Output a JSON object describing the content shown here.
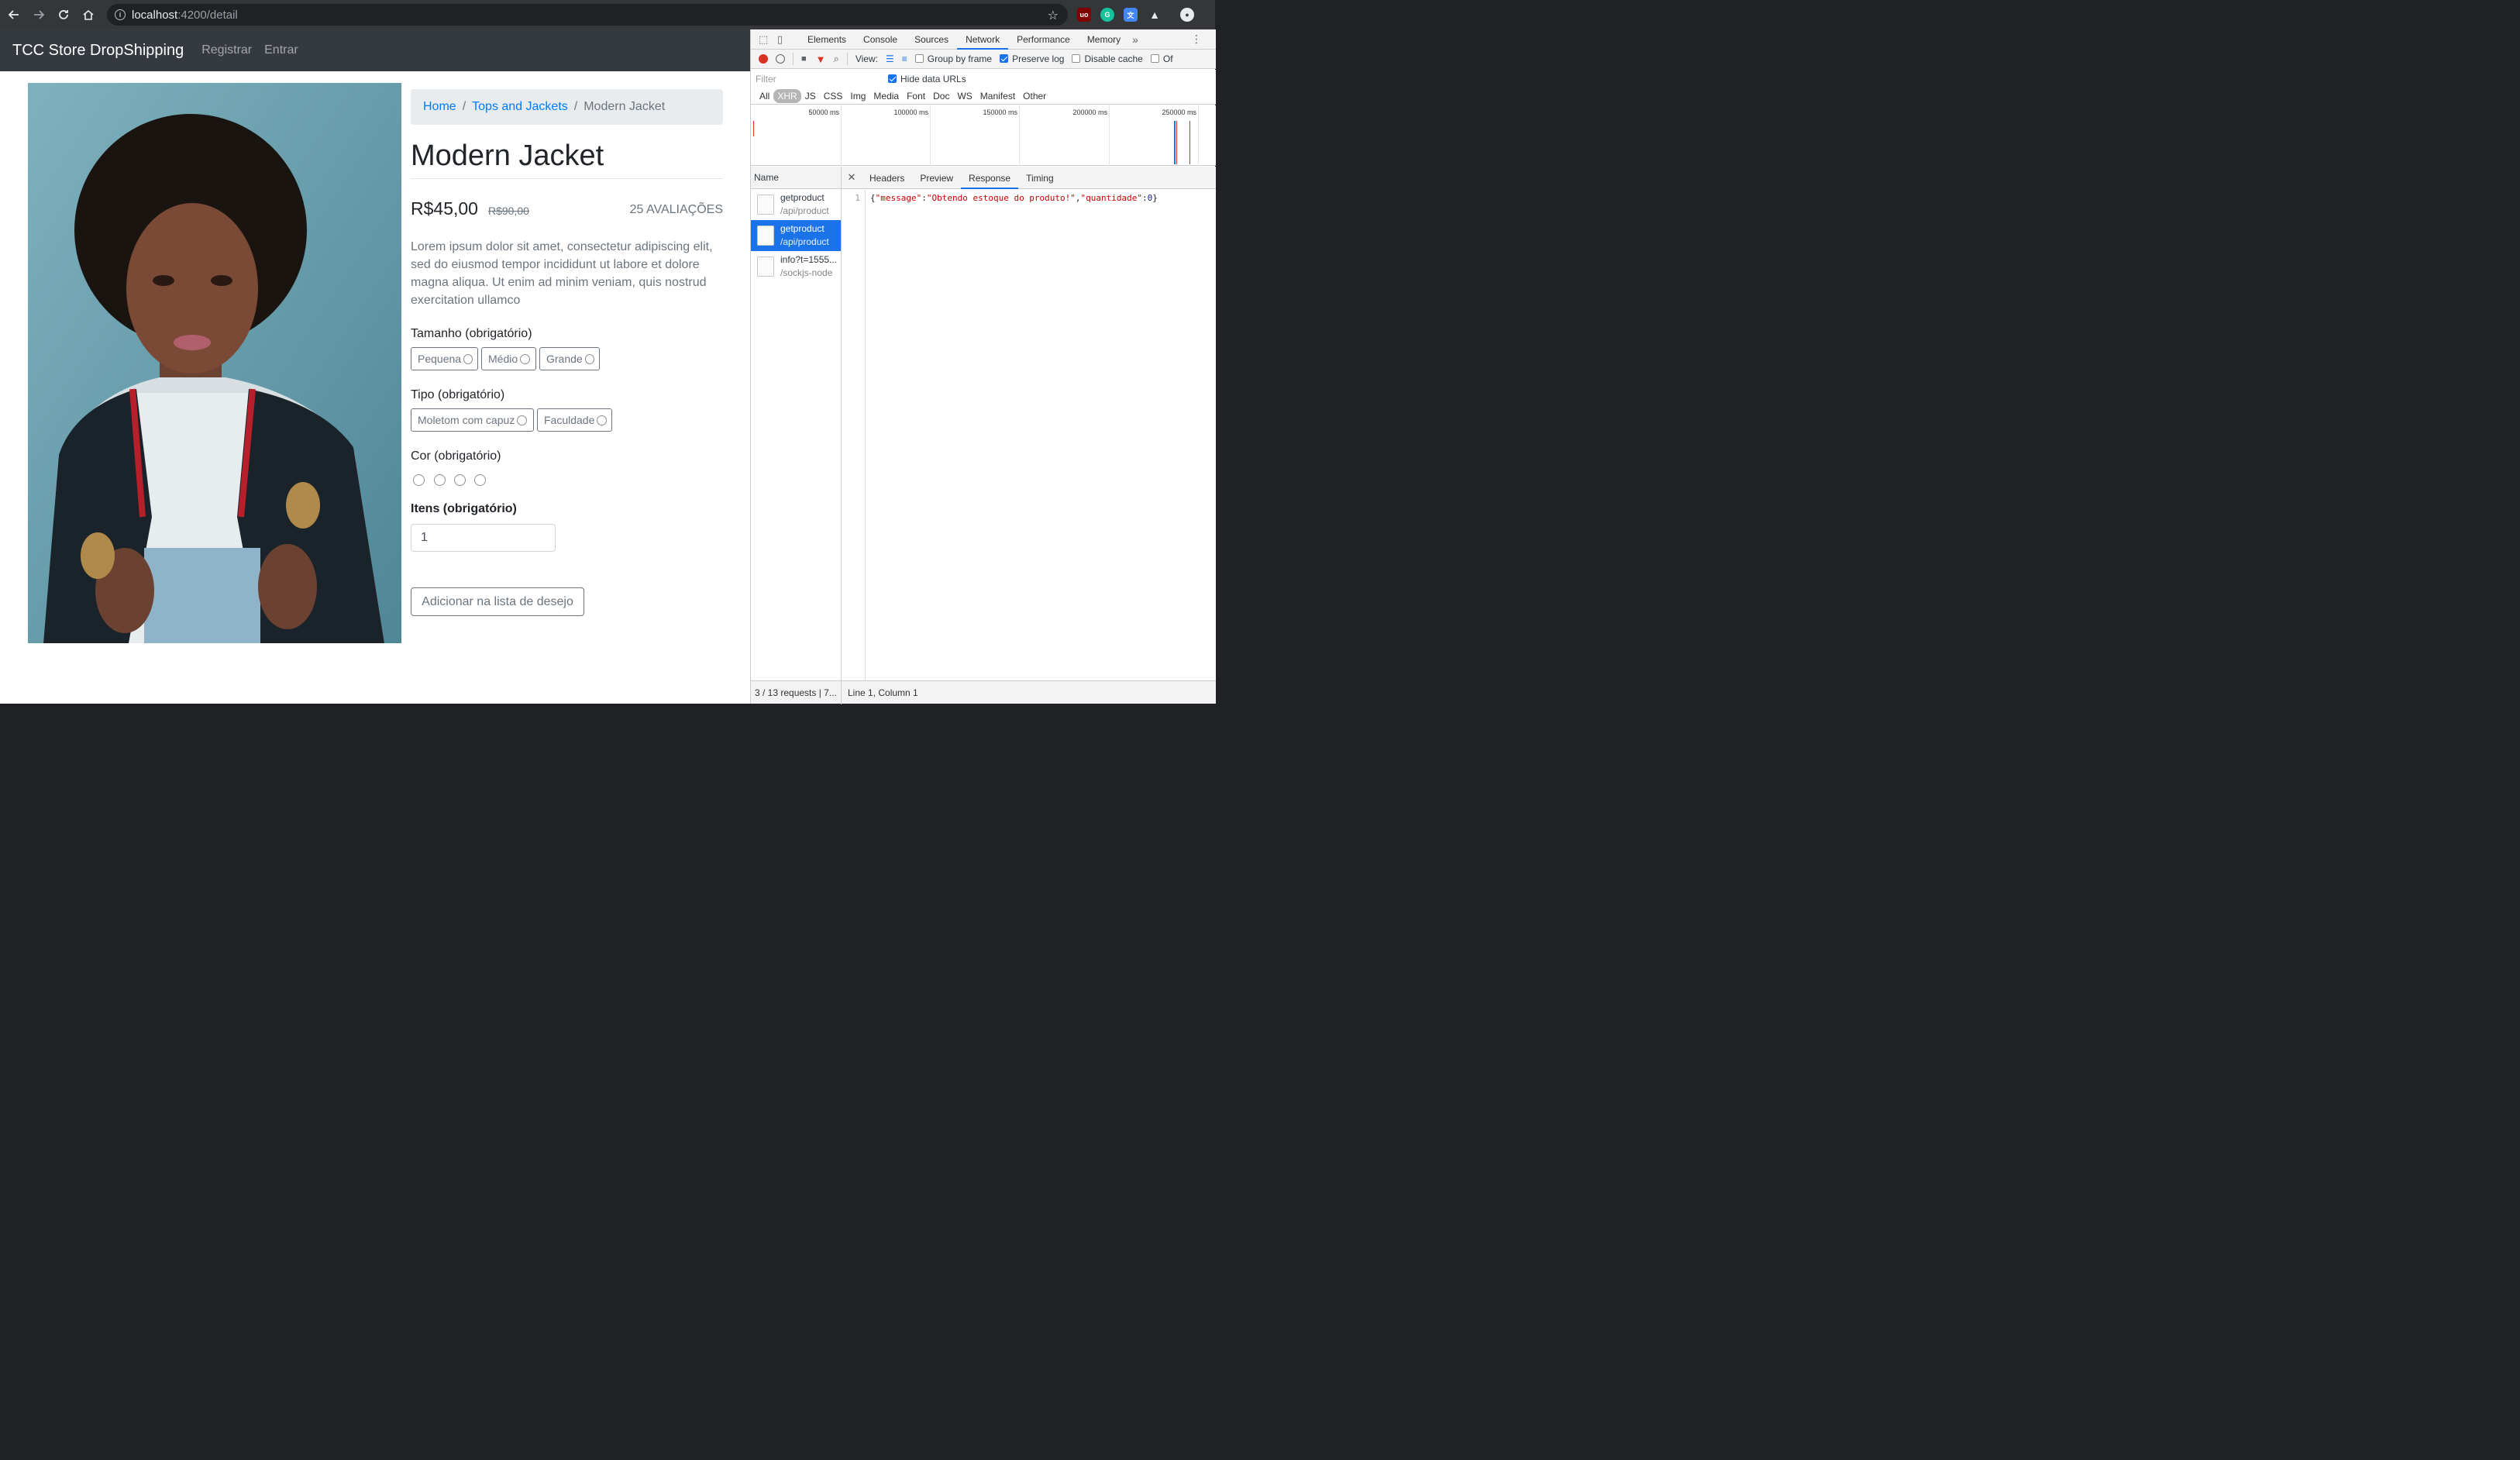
{
  "browser": {
    "url_host": "localhost",
    "url_rest": ":4200/detail"
  },
  "navbar": {
    "brand": "TCC Store DropShipping",
    "links": [
      "Registrar",
      "Entrar"
    ]
  },
  "breadcrumb": {
    "home": "Home",
    "category": "Tops and Jackets",
    "current": "Modern Jacket",
    "separator": "/"
  },
  "product": {
    "title": "Modern Jacket",
    "price": "R$45,00",
    "old_price": "R$90,00",
    "reviews": "25 AVALIAÇÕES",
    "description": "Lorem ipsum dolor sit amet, consectetur adipiscing elit, sed do eiusmod tempor incididunt ut labore et dolore magna aliqua. Ut enim ad minim veniam, quis nostrud exercitation ullamco",
    "size_label": "Tamanho (obrigatório)",
    "sizes": [
      "Pequena",
      "Médio",
      "Grande"
    ],
    "type_label": "Tipo (obrigatório)",
    "types": [
      "Moletom com capuz",
      "Faculdade"
    ],
    "color_label": "Cor (obrigatório)",
    "items_label": "Itens (obrigatório)",
    "quantity": "1",
    "wishlist_button": "Adicionar na lista de desejo"
  },
  "devtools": {
    "tabs": [
      "Elements",
      "Console",
      "Sources",
      "Network",
      "Performance",
      "Memory"
    ],
    "active_tab": "Network",
    "toolbar": {
      "view_label": "View:",
      "group_by_frame": "Group by frame",
      "preserve_log": "Preserve log",
      "disable_cache": "Disable cache",
      "offline_partial": "Of"
    },
    "filter_placeholder": "Filter",
    "hide_data_urls": "Hide data URLs",
    "types": [
      "All",
      "XHR",
      "JS",
      "CSS",
      "Img",
      "Media",
      "Font",
      "Doc",
      "WS",
      "Manifest",
      "Other"
    ],
    "active_type": "XHR",
    "timeline_ticks": [
      "50000 ms",
      "100000 ms",
      "150000 ms",
      "200000 ms",
      "250000 ms"
    ],
    "list_header": "Name",
    "requests": [
      {
        "name": "getproduct",
        "path": "/api/product"
      },
      {
        "name": "getproduct",
        "path": "/api/product"
      },
      {
        "name": "info?t=1555...",
        "path": "/sockjs-node"
      }
    ],
    "detail_tabs": [
      "Headers",
      "Preview",
      "Response",
      "Timing"
    ],
    "active_detail_tab": "Response",
    "response_line_number": "1",
    "response": {
      "open": "{",
      "key1": "\"message\"",
      "colon1": ":",
      "val1": "\"Obtendo estoque do produto!\"",
      "comma": ",",
      "key2": "\"quantidade\"",
      "colon2": ":",
      "val2": "0",
      "close": "}"
    },
    "status_requests": "3 / 13 requests | 7...",
    "status_position": "Line 1, Column 1"
  },
  "colors": {
    "navbar_bg": "#343a40",
    "link": "#007bff",
    "muted": "#6c757d",
    "devtools_accent": "#1a73e8"
  }
}
